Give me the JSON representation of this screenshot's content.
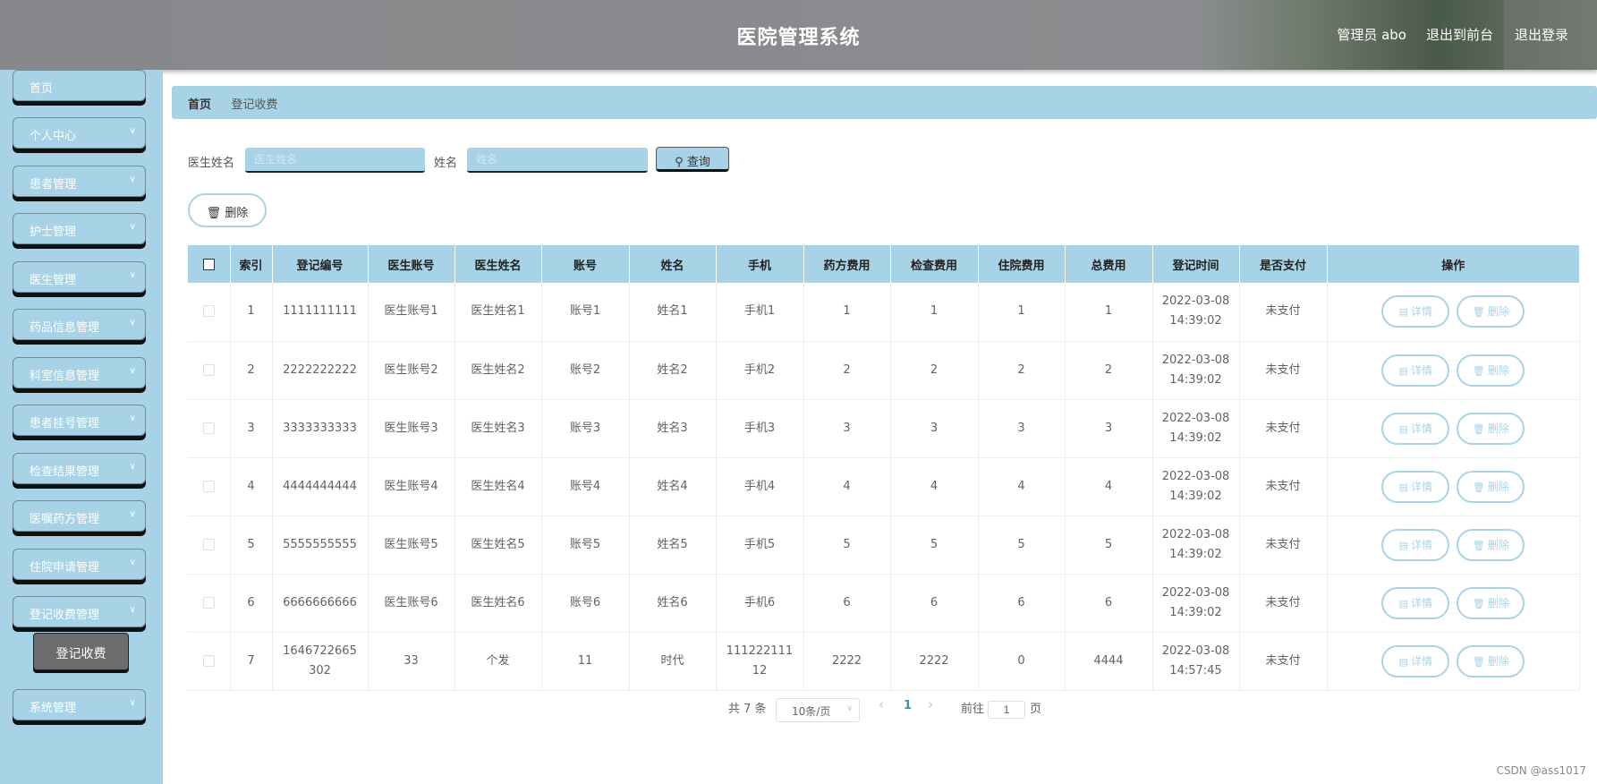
{
  "header": {
    "title": "医院管理系统",
    "user": "管理员 abo",
    "front": "退出到前台",
    "logout": "退出登录"
  },
  "sidebar": {
    "items": [
      {
        "label": "首页"
      },
      {
        "label": "个人中心"
      },
      {
        "label": "患者管理"
      },
      {
        "label": "护士管理"
      },
      {
        "label": "医生管理"
      },
      {
        "label": "药品信息管理"
      },
      {
        "label": "科室信息管理"
      },
      {
        "label": "患者挂号管理"
      },
      {
        "label": "检查结果管理"
      },
      {
        "label": "医嘱药方管理"
      },
      {
        "label": "住院申请管理"
      },
      {
        "label": "登记收费管理"
      },
      {
        "label": "系统管理"
      }
    ],
    "submenu": "登记收费"
  },
  "breadcrumb": {
    "home": "首页",
    "sep": "/",
    "current": "登记收费"
  },
  "search": {
    "doctor_label": "医生姓名",
    "doctor_placeholder": "医生姓名",
    "name_label": "姓名",
    "name_placeholder": "姓名",
    "query_label": "查询",
    "delete_label": "删除"
  },
  "table": {
    "headers": [
      "索引",
      "登记编号",
      "医生账号",
      "医生姓名",
      "账号",
      "姓名",
      "手机",
      "药方费用",
      "检查费用",
      "住院费用",
      "总费用",
      "登记时间",
      "是否支付",
      "操作"
    ],
    "detail_label": "详情",
    "delete_label": "删除",
    "rows": [
      {
        "idx": "1",
        "no": "1111111111",
        "doc_acc": "医生账号1",
        "doc_name": "医生姓名1",
        "acc": "账号1",
        "name": "姓名1",
        "phone": "手机1",
        "drug": "1",
        "check": "1",
        "hosp": "1",
        "total": "1",
        "date": "2022-03-08",
        "time": "14:39:02",
        "paid": "未支付"
      },
      {
        "idx": "2",
        "no": "2222222222",
        "doc_acc": "医生账号2",
        "doc_name": "医生姓名2",
        "acc": "账号2",
        "name": "姓名2",
        "phone": "手机2",
        "drug": "2",
        "check": "2",
        "hosp": "2",
        "total": "2",
        "date": "2022-03-08",
        "time": "14:39:02",
        "paid": "未支付"
      },
      {
        "idx": "3",
        "no": "3333333333",
        "doc_acc": "医生账号3",
        "doc_name": "医生姓名3",
        "acc": "账号3",
        "name": "姓名3",
        "phone": "手机3",
        "drug": "3",
        "check": "3",
        "hosp": "3",
        "total": "3",
        "date": "2022-03-08",
        "time": "14:39:02",
        "paid": "未支付"
      },
      {
        "idx": "4",
        "no": "4444444444",
        "doc_acc": "医生账号4",
        "doc_name": "医生姓名4",
        "acc": "账号4",
        "name": "姓名4",
        "phone": "手机4",
        "drug": "4",
        "check": "4",
        "hosp": "4",
        "total": "4",
        "date": "2022-03-08",
        "time": "14:39:02",
        "paid": "未支付"
      },
      {
        "idx": "5",
        "no": "5555555555",
        "doc_acc": "医生账号5",
        "doc_name": "医生姓名5",
        "acc": "账号5",
        "name": "姓名5",
        "phone": "手机5",
        "drug": "5",
        "check": "5",
        "hosp": "5",
        "total": "5",
        "date": "2022-03-08",
        "time": "14:39:02",
        "paid": "未支付"
      },
      {
        "idx": "6",
        "no": "6666666666",
        "doc_acc": "医生账号6",
        "doc_name": "医生姓名6",
        "acc": "账号6",
        "name": "姓名6",
        "phone": "手机6",
        "drug": "6",
        "check": "6",
        "hosp": "6",
        "total": "6",
        "date": "2022-03-08",
        "time": "14:39:02",
        "paid": "未支付"
      },
      {
        "idx": "7",
        "no": "1646722665302",
        "doc_acc": "33",
        "doc_name": "个发",
        "acc": "11",
        "name": "时代",
        "phone": "11122211112",
        "drug": "2222",
        "check": "2222",
        "hosp": "0",
        "total": "4444",
        "date": "2022-03-08",
        "time": "14:57:45",
        "paid": "未支付"
      }
    ]
  },
  "pagination": {
    "total": "共 7 条",
    "page_size": "10条/页",
    "prev": "‹",
    "current": "1",
    "next": "›",
    "goto": "前往",
    "goto_value": "1",
    "page": "页"
  },
  "watermark": "CSDN @ass1017",
  "colors": {
    "accent": "#a8d3e6",
    "header": "#8a8c8f",
    "submenu": "#6d6d6f"
  }
}
